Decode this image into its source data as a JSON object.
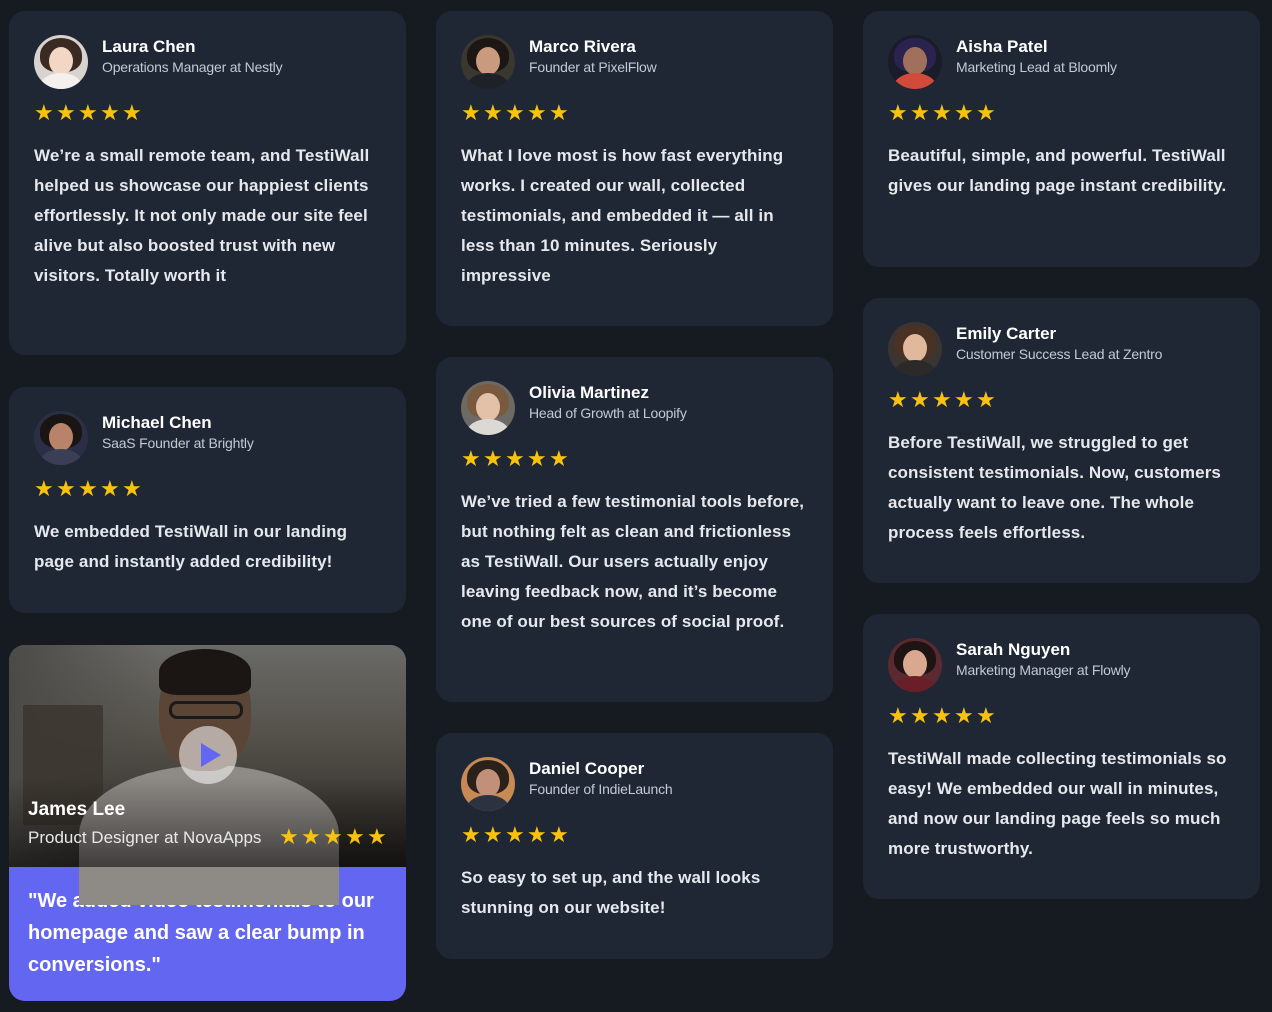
{
  "star_glyph": "★",
  "accent_color": "#6366f1",
  "star_color": "#f8c20f",
  "cards": [
    {
      "name": "Laura Chen",
      "role": "Operations Manager at Nestly",
      "rating": 5,
      "text": "We’re a small remote team, and TestiWall helped us showcase our happiest clients effortlessly. It not only made our site feel alive but also boosted trust with new visitors. Totally worth it"
    },
    {
      "name": "Marco Rivera",
      "role": "Founder at PixelFlow",
      "rating": 5,
      "text": "What I love most is how fast everything works. I created our wall, collected testimonials, and embedded it — all in less than 10 minutes. Seriously impressive"
    },
    {
      "name": "Aisha Patel",
      "role": "Marketing Lead at Bloomly",
      "rating": 5,
      "text": "Beautiful, simple, and powerful. TestiWall gives our landing page instant credibility."
    },
    {
      "name": "Michael Chen",
      "role": "SaaS Founder at Brightly",
      "rating": 5,
      "text": "We embedded TestiWall in our landing page and instantly added credibility!"
    },
    {
      "name": "Olivia Martinez",
      "role": "Head of Growth at Loopify",
      "rating": 5,
      "text": "We’ve tried a few testimonial tools before, but nothing felt as clean and frictionless as TestiWall. Our users actually enjoy leaving feedback now, and it’s become one of our best sources of social proof."
    },
    {
      "name": "Emily Carter",
      "role": "Customer Success Lead at Zentro",
      "rating": 5,
      "text": "Before TestiWall, we struggled to get consistent testimonials. Now, customers actually want to leave one. The whole process feels effortless."
    },
    {
      "name": "Daniel Cooper",
      "role": "Founder of IndieLaunch",
      "rating": 5,
      "text": "So easy to set up, and the wall looks stunning on our website!"
    },
    {
      "name": "Sarah Nguyen",
      "role": "Marketing Manager at Flowly",
      "rating": 5,
      "text": "TestiWall made collecting testimonials so easy! We embedded our wall in minutes, and now our landing page feels so much more trustworthy."
    }
  ],
  "video": {
    "name": "James Lee",
    "role": "Product Designer at NovaApps",
    "rating": 5,
    "quote": "\"We added video testimonials to our homepage and saw a clear bump in conversions.\""
  }
}
